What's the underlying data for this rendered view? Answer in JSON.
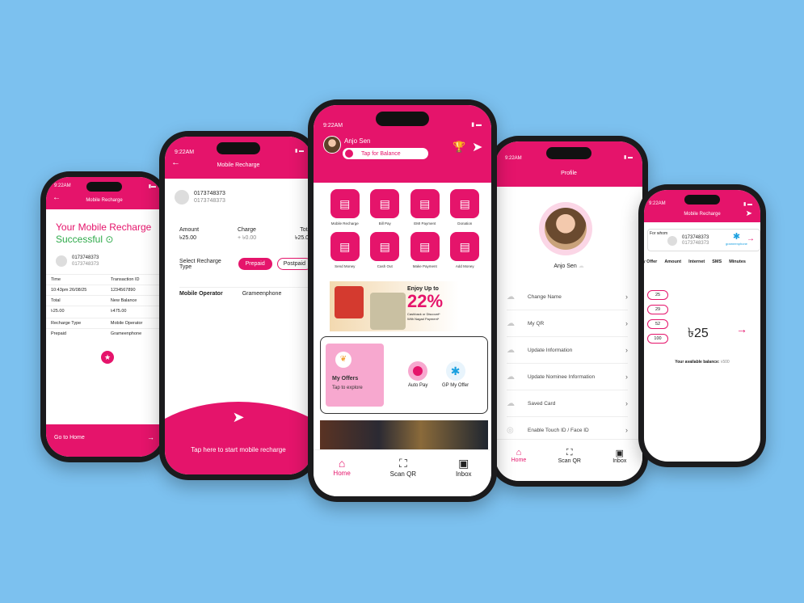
{
  "colors": {
    "brand": "#e5146b",
    "background": "#7cc1ef",
    "brand_light": "#f7a8cf"
  },
  "p1": {
    "time": "9:22AM",
    "title": "Mobile Recharge",
    "headline": "Your Mobile Recharge",
    "status": "Successful",
    "number": "0173748373",
    "number2": "0173748373",
    "rows": [
      [
        "Time",
        "Transaction ID"
      ],
      [
        "10:43pm 26/08/25",
        "1234567890"
      ],
      [
        "Total",
        "New Balance"
      ],
      [
        "৳25.00",
        "৳475.00"
      ],
      [
        "Recharge Type",
        "Mobile Operator"
      ],
      [
        "Prepaid",
        "Grameenphone"
      ]
    ],
    "go_home": "Go to Home"
  },
  "p2": {
    "time": "9:22AM",
    "title": "Mobile Recharge",
    "number": "0173748373",
    "number2": "0173748373",
    "amount_label": "Amount",
    "amount": "৳25.00",
    "charge_label": "Charge",
    "charge": "+ ৳0.00",
    "total_label": "Total",
    "total": "৳25.00",
    "type_label": "Select Recharge Type",
    "prepaid": "Prepaid",
    "postpaid": "Postpaid",
    "operator_label": "Mobile Operator",
    "operator": "Grameenphone",
    "cta": "Tap here to start mobile recharge"
  },
  "p3": {
    "time": "9:22AM",
    "name": "Anjo Sen",
    "balance_btn": "Tap for Balance",
    "services": [
      {
        "label": "Mobile Recharge",
        "icon": "phone-icon"
      },
      {
        "label": "Bill Pay",
        "icon": "bill-icon"
      },
      {
        "label": "EMI Payment",
        "icon": "emi-icon"
      },
      {
        "label": "Donation",
        "icon": "donation-icon"
      },
      {
        "label": "Send Money",
        "icon": "send-icon"
      },
      {
        "label": "Cash Out",
        "icon": "cashout-icon"
      },
      {
        "label": "Make Payment",
        "icon": "payment-icon"
      },
      {
        "label": "Add Money",
        "icon": "addmoney-icon"
      }
    ],
    "banner": {
      "line1": "Enjoy Up to",
      "big": "22%",
      "line2": "Cashback or Discount*",
      "line3": "With Nagad Payment*"
    },
    "offers_title": "My Offers",
    "offers_sub": "Tap to explore",
    "auto_pay": "Auto Pay",
    "gp_offer": "GP My Offer",
    "nav": {
      "home": "Home",
      "scan": "Scan QR",
      "inbox": "Inbox"
    }
  },
  "p4": {
    "time": "9:22AM",
    "title": "Profile",
    "name": "Anjo Sen",
    "menu": [
      "Change Name",
      "My QR",
      "Update Information",
      "Update Nominee Information",
      "Saved Card",
      "Enable Touch ID / Face ID"
    ],
    "nav": {
      "home": "Home",
      "scan": "Scan QR",
      "inbox": "Inbox"
    }
  },
  "p5": {
    "time": "9:22AM",
    "title": "Mobile Recharge",
    "for_whom": "For whom",
    "number": "0173748373",
    "number2": "0173748373",
    "operator": "grameenphone",
    "tabs": [
      "My Offer",
      "Amount",
      "Internet",
      "SMS",
      "Minutes"
    ],
    "amounts": [
      "25",
      "29",
      "52",
      "100"
    ],
    "display_amount": "৳25",
    "balance_label": "Your available balance:",
    "balance_value": "৳500"
  }
}
